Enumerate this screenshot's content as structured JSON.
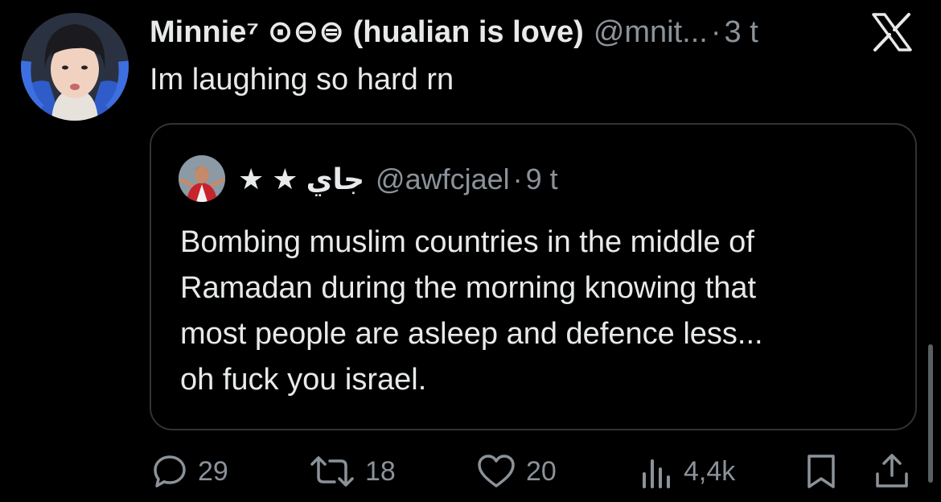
{
  "tweet": {
    "author": {
      "display_name": "Minnie⁷ ⊙⊖⊜ (hualian is love)",
      "handle": "@mnit...",
      "time": "3 t",
      "separator": "·",
      "avatar": "profile-photo"
    },
    "text": "Im laughing so hard rn",
    "header_icon": "x-logo-icon"
  },
  "quote": {
    "author": {
      "display_name": "★ ★ جاي",
      "handle": "@awfcjael",
      "time": "9 t",
      "separator": "·",
      "avatar": "profile-photo"
    },
    "lines": [
      "Bombing muslim countries in the middle of",
      "Ramadan during the morning knowing that",
      "most people are asleep and defence less...",
      "oh fuck you israel."
    ]
  },
  "actions": {
    "reply": {
      "icon": "reply-icon",
      "count": "29"
    },
    "retweet": {
      "icon": "retweet-icon",
      "count": "18"
    },
    "like": {
      "icon": "heart-icon",
      "count": "20"
    },
    "views": {
      "icon": "views-icon",
      "count": "4,4k"
    },
    "bookmark": {
      "icon": "bookmark-icon"
    },
    "share": {
      "icon": "share-icon"
    }
  },
  "colors": {
    "background": "#000000",
    "text": "#e7e9ea",
    "secondary": "#8b9299",
    "border": "#2f3336"
  }
}
